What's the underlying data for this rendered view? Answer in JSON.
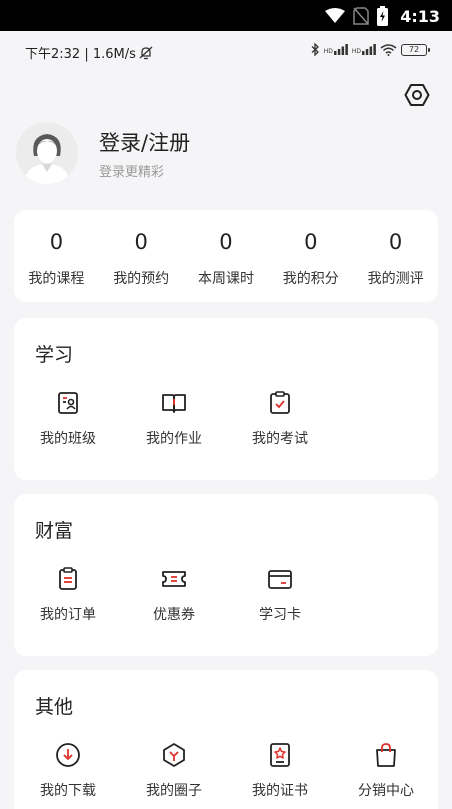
{
  "system_bar": {
    "time": "4:13"
  },
  "status_row": {
    "left_text": "下午2:32 | 1.6M/s",
    "hd1": "HD",
    "hd2": "HD",
    "battery": "72"
  },
  "profile": {
    "title": "登录/注册",
    "subtitle": "登录更精彩"
  },
  "stats": [
    {
      "value": "0",
      "label": "我的课程"
    },
    {
      "value": "0",
      "label": "我的预约"
    },
    {
      "value": "0",
      "label": "本周课时"
    },
    {
      "value": "0",
      "label": "我的积分"
    },
    {
      "value": "0",
      "label": "我的测评"
    }
  ],
  "study": {
    "title": "学习",
    "items": [
      {
        "label": "我的班级",
        "icon": "class-icon"
      },
      {
        "label": "我的作业",
        "icon": "homework-book-icon"
      },
      {
        "label": "我的考试",
        "icon": "exam-clipboard-icon"
      }
    ]
  },
  "wealth": {
    "title": "财富",
    "items": [
      {
        "label": "我的订单",
        "icon": "order-icon"
      },
      {
        "label": "优惠券",
        "icon": "coupon-icon"
      },
      {
        "label": "学习卡",
        "icon": "study-card-icon"
      }
    ]
  },
  "other": {
    "title": "其他",
    "items": [
      {
        "label": "我的下载",
        "icon": "download-icon"
      },
      {
        "label": "我的圈子",
        "icon": "circle-icon"
      },
      {
        "label": "我的证书",
        "icon": "certificate-icon"
      },
      {
        "label": "分销中心",
        "icon": "shopping-bag-icon"
      }
    ]
  },
  "colors": {
    "accent": "#e0322c",
    "text": "#222222",
    "subtext": "#9a9a9a",
    "background": "#f5f5f7"
  }
}
